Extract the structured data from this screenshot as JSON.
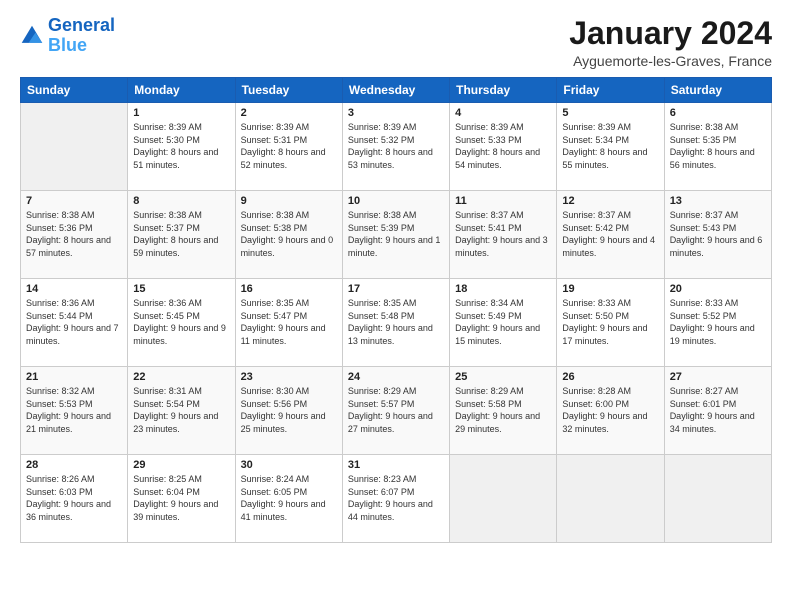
{
  "logo": {
    "line1": "General",
    "line2": "Blue"
  },
  "title": "January 2024",
  "location": "Ayguemorte-les-Graves, France",
  "days_of_week": [
    "Sunday",
    "Monday",
    "Tuesday",
    "Wednesday",
    "Thursday",
    "Friday",
    "Saturday"
  ],
  "weeks": [
    [
      {
        "day": "",
        "sunrise": "",
        "sunset": "",
        "daylight": ""
      },
      {
        "day": "1",
        "sunrise": "Sunrise: 8:39 AM",
        "sunset": "Sunset: 5:30 PM",
        "daylight": "Daylight: 8 hours and 51 minutes."
      },
      {
        "day": "2",
        "sunrise": "Sunrise: 8:39 AM",
        "sunset": "Sunset: 5:31 PM",
        "daylight": "Daylight: 8 hours and 52 minutes."
      },
      {
        "day": "3",
        "sunrise": "Sunrise: 8:39 AM",
        "sunset": "Sunset: 5:32 PM",
        "daylight": "Daylight: 8 hours and 53 minutes."
      },
      {
        "day": "4",
        "sunrise": "Sunrise: 8:39 AM",
        "sunset": "Sunset: 5:33 PM",
        "daylight": "Daylight: 8 hours and 54 minutes."
      },
      {
        "day": "5",
        "sunrise": "Sunrise: 8:39 AM",
        "sunset": "Sunset: 5:34 PM",
        "daylight": "Daylight: 8 hours and 55 minutes."
      },
      {
        "day": "6",
        "sunrise": "Sunrise: 8:38 AM",
        "sunset": "Sunset: 5:35 PM",
        "daylight": "Daylight: 8 hours and 56 minutes."
      }
    ],
    [
      {
        "day": "7",
        "sunrise": "Sunrise: 8:38 AM",
        "sunset": "Sunset: 5:36 PM",
        "daylight": "Daylight: 8 hours and 57 minutes."
      },
      {
        "day": "8",
        "sunrise": "Sunrise: 8:38 AM",
        "sunset": "Sunset: 5:37 PM",
        "daylight": "Daylight: 8 hours and 59 minutes."
      },
      {
        "day": "9",
        "sunrise": "Sunrise: 8:38 AM",
        "sunset": "Sunset: 5:38 PM",
        "daylight": "Daylight: 9 hours and 0 minutes."
      },
      {
        "day": "10",
        "sunrise": "Sunrise: 8:38 AM",
        "sunset": "Sunset: 5:39 PM",
        "daylight": "Daylight: 9 hours and 1 minute."
      },
      {
        "day": "11",
        "sunrise": "Sunrise: 8:37 AM",
        "sunset": "Sunset: 5:41 PM",
        "daylight": "Daylight: 9 hours and 3 minutes."
      },
      {
        "day": "12",
        "sunrise": "Sunrise: 8:37 AM",
        "sunset": "Sunset: 5:42 PM",
        "daylight": "Daylight: 9 hours and 4 minutes."
      },
      {
        "day": "13",
        "sunrise": "Sunrise: 8:37 AM",
        "sunset": "Sunset: 5:43 PM",
        "daylight": "Daylight: 9 hours and 6 minutes."
      }
    ],
    [
      {
        "day": "14",
        "sunrise": "Sunrise: 8:36 AM",
        "sunset": "Sunset: 5:44 PM",
        "daylight": "Daylight: 9 hours and 7 minutes."
      },
      {
        "day": "15",
        "sunrise": "Sunrise: 8:36 AM",
        "sunset": "Sunset: 5:45 PM",
        "daylight": "Daylight: 9 hours and 9 minutes."
      },
      {
        "day": "16",
        "sunrise": "Sunrise: 8:35 AM",
        "sunset": "Sunset: 5:47 PM",
        "daylight": "Daylight: 9 hours and 11 minutes."
      },
      {
        "day": "17",
        "sunrise": "Sunrise: 8:35 AM",
        "sunset": "Sunset: 5:48 PM",
        "daylight": "Daylight: 9 hours and 13 minutes."
      },
      {
        "day": "18",
        "sunrise": "Sunrise: 8:34 AM",
        "sunset": "Sunset: 5:49 PM",
        "daylight": "Daylight: 9 hours and 15 minutes."
      },
      {
        "day": "19",
        "sunrise": "Sunrise: 8:33 AM",
        "sunset": "Sunset: 5:50 PM",
        "daylight": "Daylight: 9 hours and 17 minutes."
      },
      {
        "day": "20",
        "sunrise": "Sunrise: 8:33 AM",
        "sunset": "Sunset: 5:52 PM",
        "daylight": "Daylight: 9 hours and 19 minutes."
      }
    ],
    [
      {
        "day": "21",
        "sunrise": "Sunrise: 8:32 AM",
        "sunset": "Sunset: 5:53 PM",
        "daylight": "Daylight: 9 hours and 21 minutes."
      },
      {
        "day": "22",
        "sunrise": "Sunrise: 8:31 AM",
        "sunset": "Sunset: 5:54 PM",
        "daylight": "Daylight: 9 hours and 23 minutes."
      },
      {
        "day": "23",
        "sunrise": "Sunrise: 8:30 AM",
        "sunset": "Sunset: 5:56 PM",
        "daylight": "Daylight: 9 hours and 25 minutes."
      },
      {
        "day": "24",
        "sunrise": "Sunrise: 8:29 AM",
        "sunset": "Sunset: 5:57 PM",
        "daylight": "Daylight: 9 hours and 27 minutes."
      },
      {
        "day": "25",
        "sunrise": "Sunrise: 8:29 AM",
        "sunset": "Sunset: 5:58 PM",
        "daylight": "Daylight: 9 hours and 29 minutes."
      },
      {
        "day": "26",
        "sunrise": "Sunrise: 8:28 AM",
        "sunset": "Sunset: 6:00 PM",
        "daylight": "Daylight: 9 hours and 32 minutes."
      },
      {
        "day": "27",
        "sunrise": "Sunrise: 8:27 AM",
        "sunset": "Sunset: 6:01 PM",
        "daylight": "Daylight: 9 hours and 34 minutes."
      }
    ],
    [
      {
        "day": "28",
        "sunrise": "Sunrise: 8:26 AM",
        "sunset": "Sunset: 6:03 PM",
        "daylight": "Daylight: 9 hours and 36 minutes."
      },
      {
        "day": "29",
        "sunrise": "Sunrise: 8:25 AM",
        "sunset": "Sunset: 6:04 PM",
        "daylight": "Daylight: 9 hours and 39 minutes."
      },
      {
        "day": "30",
        "sunrise": "Sunrise: 8:24 AM",
        "sunset": "Sunset: 6:05 PM",
        "daylight": "Daylight: 9 hours and 41 minutes."
      },
      {
        "day": "31",
        "sunrise": "Sunrise: 8:23 AM",
        "sunset": "Sunset: 6:07 PM",
        "daylight": "Daylight: 9 hours and 44 minutes."
      },
      {
        "day": "",
        "sunrise": "",
        "sunset": "",
        "daylight": ""
      },
      {
        "day": "",
        "sunrise": "",
        "sunset": "",
        "daylight": ""
      },
      {
        "day": "",
        "sunrise": "",
        "sunset": "",
        "daylight": ""
      }
    ]
  ]
}
